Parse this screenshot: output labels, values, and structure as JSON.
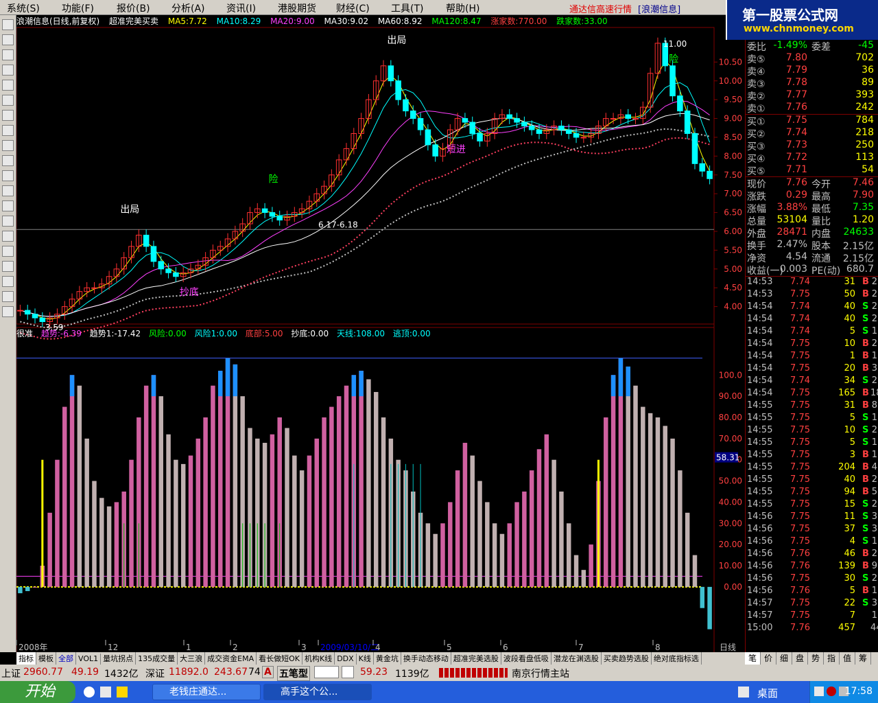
{
  "menu": {
    "items": [
      "系统(S)",
      "功能(F)",
      "报价(B)",
      "分析(A)",
      "资讯(I)",
      "港股期货",
      "财经(C)",
      "工具(T)",
      "帮助(H)"
    ],
    "title": "通达信高速行情",
    "app": "[浪潮信息]"
  },
  "logo": {
    "line1": "第一股票公式网",
    "line2": "www.chnmoney.com"
  },
  "toolbar": {
    "icons": [
      "pointer",
      "kline",
      "line",
      "bar",
      "table",
      "grid",
      "list",
      "calc",
      "chart",
      "people",
      "search",
      "rank",
      "eye",
      "info",
      "dollar",
      "pie",
      "swap",
      "pen",
      "up",
      "down"
    ]
  },
  "chart": {
    "info": {
      "stock": "浪潮信息(日线,前复权)",
      "formula": "超准完美买卖",
      "ma5": "MA5:7.72",
      "ma10": "MA10:8.29",
      "ma20": "MA20:9.00",
      "ma30": "MA30:9.02",
      "ma60": "MA60:8.92",
      "ma120": "MA120:8.47",
      "up": "涨家数:770.00",
      "down": "跌家数:33.00"
    },
    "ind": {
      "name": "很准",
      "a": "趋势:-6.39",
      "b": "趋势1:-17.42",
      "c": "风险:0.00",
      "d": "风险1:0.00",
      "e": "底部:5.00",
      "f": "抄底:0.00",
      "g": "天线:108.00",
      "h": "逃顶:0.00"
    },
    "labels": {
      "max": "11.00",
      "min": "3.59",
      "mid": "6.17-6.18",
      "cur": "58.31",
      "sell": "出局",
      "warn": "险",
      "short": "短进",
      "bottom": "抄底",
      "period": "日线"
    },
    "price_axis": [
      "10.50",
      "10.00",
      "9.50",
      "9.00",
      "8.50",
      "8.00",
      "7.50",
      "7.00",
      "6.50",
      "6.00",
      "5.50",
      "5.00",
      "4.50",
      "4.00"
    ],
    "ind_axis": [
      "100.0",
      "90.00",
      "80.00",
      "70.00",
      "60.00",
      "50.00",
      "40.00",
      "30.00",
      "20.00",
      "10.00",
      "0.00"
    ],
    "date_axis": [
      {
        "t": "2008年"
      },
      {
        "t": "12"
      },
      {
        "t": "1"
      },
      {
        "t": "2"
      },
      {
        "t": "3"
      },
      {
        "t": "2009/03/10/二"
      },
      {
        "t": "4"
      },
      {
        "t": "5"
      },
      {
        "t": "6"
      },
      {
        "t": "7"
      },
      {
        "t": "8"
      }
    ],
    "price_data": [
      3.9,
      3.8,
      3.7,
      3.6,
      3.7,
      3.8,
      4.0,
      4.2,
      4.4,
      4.5,
      4.5,
      4.6,
      4.8,
      5.0,
      5.3,
      5.6,
      5.9,
      5.6,
      5.2,
      5.0,
      4.9,
      4.8,
      4.9,
      5.0,
      5.1,
      5.3,
      5.5,
      5.6,
      5.8,
      6.0,
      6.2,
      6.5,
      6.6,
      6.5,
      6.4,
      6.3,
      6.4,
      6.5,
      6.6,
      6.8,
      7.0,
      7.2,
      7.5,
      7.9,
      8.2,
      8.6,
      9.0,
      9.5,
      10.0,
      10.4,
      10.0,
      9.5,
      9.2,
      9.0,
      8.7,
      8.3,
      8.0,
      8.2,
      8.7,
      9.0,
      8.9,
      8.6,
      8.4,
      8.6,
      9.0,
      9.1,
      9.0,
      8.9,
      8.8,
      8.7,
      8.6,
      8.7,
      8.8,
      8.7,
      8.6,
      8.5,
      8.5,
      8.6,
      8.8,
      9.0,
      9.0,
      9.1,
      9.0,
      9.0,
      9.3,
      10.2,
      11.0,
      10.4,
      9.6,
      9.2,
      8.6,
      7.8,
      7.6,
      7.4
    ],
    "ind_data": [
      -3,
      -2,
      0,
      10,
      35,
      60,
      85,
      100,
      95,
      70,
      50,
      42,
      38,
      40,
      45,
      60,
      80,
      95,
      100,
      90,
      72,
      60,
      58,
      62,
      70,
      80,
      95,
      102,
      108,
      105,
      90,
      75,
      70,
      68,
      72,
      80,
      75,
      62,
      55,
      62,
      70,
      80,
      85,
      90,
      95,
      100,
      102,
      98,
      92,
      80,
      70,
      60,
      55,
      45,
      35,
      30,
      25,
      30,
      40,
      55,
      68,
      62,
      50,
      40,
      30,
      25,
      30,
      40,
      45,
      55,
      65,
      72,
      60,
      45,
      30,
      15,
      8,
      20,
      50,
      80,
      100,
      108,
      104,
      95,
      85,
      82,
      80,
      76,
      70,
      55,
      35,
      15,
      -10,
      -20
    ]
  },
  "quote": {
    "top": {
      "l": "委比",
      "p": "-1.49%",
      "l2": "委差",
      "v": "-45"
    },
    "asks": [
      {
        "l": "卖⑤",
        "p": "7.80",
        "v": "702"
      },
      {
        "l": "卖④",
        "p": "7.79",
        "v": "36"
      },
      {
        "l": "卖③",
        "p": "7.78",
        "v": "89"
      },
      {
        "l": "卖②",
        "p": "7.77",
        "v": "393"
      },
      {
        "l": "卖①",
        "p": "7.76",
        "v": "242"
      }
    ],
    "bids": [
      {
        "l": "买①",
        "p": "7.75",
        "v": "784"
      },
      {
        "l": "买②",
        "p": "7.74",
        "v": "218"
      },
      {
        "l": "买③",
        "p": "7.73",
        "v": "250"
      },
      {
        "l": "买④",
        "p": "7.72",
        "v": "113"
      },
      {
        "l": "买⑤",
        "p": "7.71",
        "v": "54"
      }
    ],
    "stats": [
      {
        "a": "现价",
        "b": "7.76",
        "c": "今开",
        "d": "7.46",
        "bc": "#ff4040",
        "dc": "#ff4040"
      },
      {
        "a": "涨跌",
        "b": "0.29",
        "c": "最高",
        "d": "7.90",
        "bc": "#ff4040",
        "dc": "#ff4040"
      },
      {
        "a": "涨幅",
        "b": "3.88%",
        "c": "最低",
        "d": "7.35",
        "bc": "#ff4040",
        "dc": "#00ff00"
      },
      {
        "a": "总量",
        "b": "53104",
        "c": "量比",
        "d": "1.20",
        "bc": "#ffff00",
        "dc": "#ffff00"
      },
      {
        "a": "外盘",
        "b": "28471",
        "c": "内盘",
        "d": "24633",
        "bc": "#ff4040",
        "dc": "#00ff00"
      },
      {
        "a": "换手",
        "b": "2.47%",
        "c": "股本",
        "d": "2.15亿",
        "bc": "#c0c0c0",
        "dc": "#c0c0c0"
      },
      {
        "a": "净资",
        "b": "4.54",
        "c": "流通",
        "d": "2.15亿",
        "bc": "#c0c0c0",
        "dc": "#c0c0c0"
      },
      {
        "a": "收益(一)",
        "b": "0.003",
        "c": "PE(动)",
        "d": "680.7",
        "bc": "#c0c0c0",
        "dc": "#c0c0c0"
      }
    ],
    "ticks": [
      {
        "t": "14:53",
        "p": "7.74",
        "v": "31",
        "s": "B",
        "n": "2"
      },
      {
        "t": "14:53",
        "p": "7.75",
        "v": "50",
        "s": "B",
        "n": "2"
      },
      {
        "t": "14:54",
        "p": "7.74",
        "v": "40",
        "s": "S",
        "n": "2"
      },
      {
        "t": "14:54",
        "p": "7.74",
        "v": "40",
        "s": "S",
        "n": "2"
      },
      {
        "t": "14:54",
        "p": "7.74",
        "v": "5",
        "s": "S",
        "n": "1"
      },
      {
        "t": "14:54",
        "p": "7.75",
        "v": "10",
        "s": "B",
        "n": "2"
      },
      {
        "t": "14:54",
        "p": "7.75",
        "v": "1",
        "s": "B",
        "n": "1"
      },
      {
        "t": "14:54",
        "p": "7.75",
        "v": "20",
        "s": "B",
        "n": "3"
      },
      {
        "t": "14:54",
        "p": "7.74",
        "v": "34",
        "s": "S",
        "n": "2"
      },
      {
        "t": "14:54",
        "p": "7.75",
        "v": "165",
        "s": "B",
        "n": "18"
      },
      {
        "t": "14:55",
        "p": "7.75",
        "v": "31",
        "s": "B",
        "n": "8"
      },
      {
        "t": "14:55",
        "p": "7.75",
        "v": "5",
        "s": "S",
        "n": "1"
      },
      {
        "t": "14:55",
        "p": "7.75",
        "v": "10",
        "s": "S",
        "n": "2"
      },
      {
        "t": "14:55",
        "p": "7.75",
        "v": "5",
        "s": "S",
        "n": "1"
      },
      {
        "t": "14:55",
        "p": "7.75",
        "v": "3",
        "s": "B",
        "n": "1"
      },
      {
        "t": "14:55",
        "p": "7.75",
        "v": "204",
        "s": "B",
        "n": "4"
      },
      {
        "t": "14:55",
        "p": "7.75",
        "v": "40",
        "s": "B",
        "n": "2"
      },
      {
        "t": "14:55",
        "p": "7.75",
        "v": "94",
        "s": "B",
        "n": "5"
      },
      {
        "t": "14:55",
        "p": "7.75",
        "v": "15",
        "s": "S",
        "n": "2"
      },
      {
        "t": "14:56",
        "p": "7.75",
        "v": "11",
        "s": "S",
        "n": "3"
      },
      {
        "t": "14:56",
        "p": "7.75",
        "v": "37",
        "s": "S",
        "n": "3"
      },
      {
        "t": "14:56",
        "p": "7.75",
        "v": "4",
        "s": "S",
        "n": "1"
      },
      {
        "t": "14:56",
        "p": "7.76",
        "v": "46",
        "s": "B",
        "n": "2"
      },
      {
        "t": "14:56",
        "p": "7.76",
        "v": "139",
        "s": "B",
        "n": "9"
      },
      {
        "t": "14:56",
        "p": "7.75",
        "v": "30",
        "s": "S",
        "n": "2"
      },
      {
        "t": "14:56",
        "p": "7.76",
        "v": "5",
        "s": "B",
        "n": "1"
      },
      {
        "t": "14:57",
        "p": "7.75",
        "v": "22",
        "s": "S",
        "n": "3"
      },
      {
        "t": "14:57",
        "p": "7.75",
        "v": "7",
        "s": "",
        "n": "1"
      },
      {
        "t": "15:00",
        "p": "7.76",
        "v": "457",
        "s": "",
        "n": "44"
      }
    ]
  },
  "tabs": [
    "指标",
    "模板",
    "全部",
    "VOL1",
    "量坑拐点",
    "135成交量",
    "大三浪",
    "成交资金EMA",
    "看长做短OK",
    "机构K线",
    "DDX",
    "K线",
    "黄金坑",
    "换手动态移动",
    "超准完美选股",
    "波段看盘低吸",
    "潜龙在渊选股",
    "买卖趋势选股",
    "绝对底指标选"
  ],
  "rtabs": [
    "笔",
    "价",
    "细",
    "盘",
    "势",
    "指",
    "值",
    "筹"
  ],
  "status": {
    "sh_label": "上证",
    "sh_val": "2960.77",
    "sh_chg": "49.19",
    "sh_amt": "1432亿",
    "sz_label": "深证",
    "sz_val": "11892.0",
    "sz_chg": "243.67",
    "sz_n": "74",
    "btn_a": "A",
    "btn_font": "五笔型",
    "s_val": "59.23",
    "s_amt": "1139亿",
    "market": "南京行情主站"
  },
  "taskbar": {
    "start": "开始",
    "task1": "老钱庄通达...",
    "task2": "高手这个公...",
    "desktop": "桌面",
    "clock": "17:58"
  }
}
